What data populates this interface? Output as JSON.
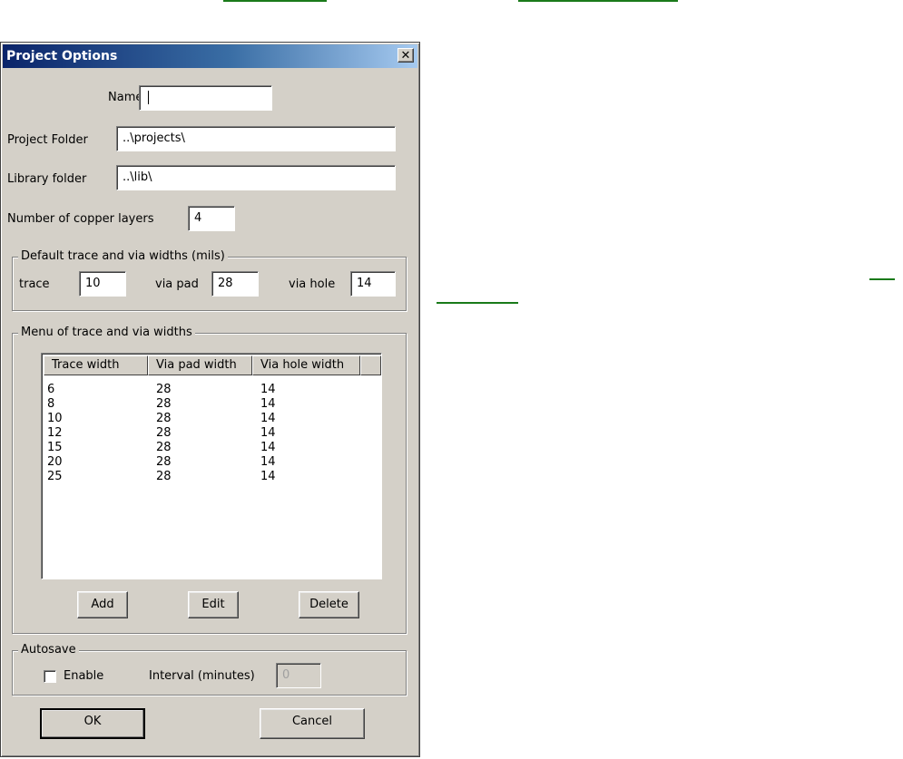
{
  "dialog": {
    "title": "Project Options",
    "close_glyph": "✕",
    "name": {
      "label": "Name",
      "value": ""
    },
    "project_folder": {
      "label": "Project Folder",
      "value": "..\\projects\\"
    },
    "library_folder": {
      "label": "Library folder",
      "value": "..\\lib\\"
    },
    "copper_layers": {
      "label": "Number of copper layers",
      "value": "4"
    },
    "default_widths": {
      "title": "Default trace and via widths (mils)",
      "trace_label": "trace",
      "trace_value": "10",
      "via_pad_label": "via pad",
      "via_pad_value": "28",
      "via_hole_label": "via hole",
      "via_hole_value": "14"
    },
    "menu": {
      "title": "Menu of trace and via widths",
      "columns": [
        "Trace width",
        "Via pad width",
        "Via hole width"
      ],
      "rows": [
        [
          "6",
          "28",
          "14"
        ],
        [
          "8",
          "28",
          "14"
        ],
        [
          "10",
          "28",
          "14"
        ],
        [
          "12",
          "28",
          "14"
        ],
        [
          "15",
          "28",
          "14"
        ],
        [
          "20",
          "28",
          "14"
        ],
        [
          "25",
          "28",
          "14"
        ]
      ],
      "add_label": "Add",
      "edit_label": "Edit",
      "delete_label": "Delete"
    },
    "autosave": {
      "title": "Autosave",
      "enable_label": "Enable",
      "enable_checked": false,
      "interval_label": "Interval (minutes)",
      "interval_value": "0"
    },
    "ok_label": "OK",
    "cancel_label": "Cancel"
  },
  "colors": {
    "dialog_face": "#d4d0c8",
    "titlebar_start": "#0a246a",
    "titlebar_end": "#a6caf0",
    "link_underline": "#1a7a1a"
  }
}
